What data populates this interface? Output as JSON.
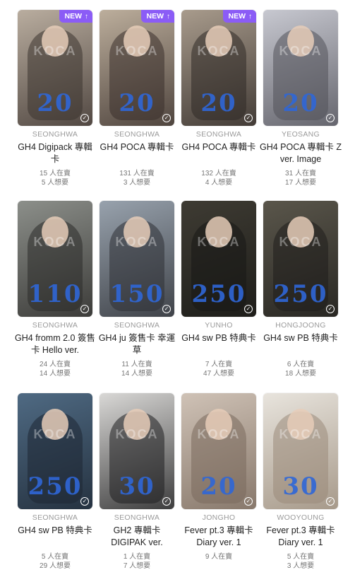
{
  "cards": [
    {
      "member": "SEONGHWA",
      "title": "GH4 Digipack 專輯卡",
      "stock": "15 人在賣",
      "want": "5 人想要",
      "price": "20",
      "new": "NEW",
      "bg": "#b9ad9f",
      "fig": "#3d3430"
    },
    {
      "member": "SEONGHWA",
      "title": "GH4 POCA 專輯卡",
      "stock": "131 人在賣",
      "want": "3 人想要",
      "price": "20",
      "new": "NEW",
      "bg": "#bcae9c",
      "fig": "#3a302c"
    },
    {
      "member": "SEONGHWA",
      "title": "GH4 POCA 專輯卡",
      "stock": "132 人在賣",
      "want": "4 人想要",
      "price": "20",
      "new": "NEW",
      "bg": "#a89b8c",
      "fig": "#2f2926"
    },
    {
      "member": "YEOSANG",
      "title": "GH4 POCA 專輯卡 Z ver. Image",
      "stock": "31 人在賣",
      "want": "17 人想要",
      "price": "20",
      "new": "",
      "bg": "#c7c8d0",
      "fig": "#52525a"
    },
    {
      "member": "SEONGHWA",
      "title": "GH4 fromm 2.0 簽售卡 Hello ver.",
      "stock": "24 人在賣",
      "want": "14 人想要",
      "price": "110",
      "new": "",
      "bg": "#8c8f8a",
      "fig": "#2c2b29"
    },
    {
      "member": "SEONGHWA",
      "title": "GH4 ju 簽售卡 幸運草",
      "stock": "11 人在賣",
      "want": "14 人想要",
      "price": "150",
      "new": "",
      "bg": "#98a2ad",
      "fig": "#2e3035"
    },
    {
      "member": "YUNHO",
      "title": "GH4 sw PB 特典卡",
      "stock": "7 人在賣",
      "want": "47 人想要",
      "price": "250",
      "new": "",
      "bg": "#3e3b33",
      "fig": "#181815"
    },
    {
      "member": "HONGJOONG",
      "title": "GH4 sw PB 特典卡",
      "stock": "6 人在賣",
      "want": "18 人想要",
      "price": "250",
      "new": "",
      "bg": "#5a564b",
      "fig": "#1f1e1b"
    },
    {
      "member": "SEONGHWA",
      "title": "GH4 sw PB 特典卡",
      "stock": "5 人在賣",
      "want": "29 人想要",
      "price": "250",
      "new": "",
      "bg": "#4f6a83",
      "fig": "#1d2733"
    },
    {
      "member": "SEONGHWA",
      "title": "GH2 專輯卡 DIGIPAK ver.",
      "stock": "1 人在賣",
      "want": "7 人想要",
      "price": "30",
      "new": "",
      "bg": "#d9d8d6",
      "fig": "#1f1f20"
    },
    {
      "member": "JONGHO",
      "title": "Fever pt.3 專輯卡 Diary ver. 1",
      "stock": "9 人在賣",
      "want": "",
      "price": "20",
      "new": "",
      "bg": "#cfc2b6",
      "fig": "#7a6a5d"
    },
    {
      "member": "WOOYOUNG",
      "title": "Fever pt.3 專輯卡 Diary ver. 1",
      "stock": "5 人在賣",
      "want": "3 人想要",
      "price": "30",
      "new": "",
      "bg": "#e8e4dd",
      "fig": "#9a8b7a"
    }
  ],
  "icons": {
    "new_arrow": "arrow-up-icon",
    "check": "check-circle-icon"
  },
  "watermark": "KOCA"
}
